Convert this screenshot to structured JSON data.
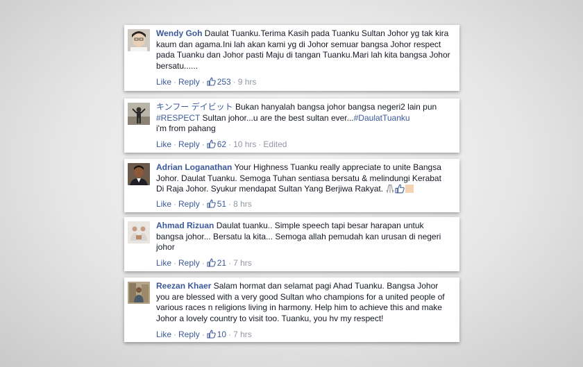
{
  "comments": [
    {
      "author": "Wendy Goh",
      "text": "Daulat Tuanku.Terima Kasih pada Tuanku Sultan Johor yg tak kira kaum dan agama.Ini lah akan kami yg di Johor semuar bangsa Johor respect pada Tuanku dan Johor pasti Maju di tangan Tuanku.Mari lah kita bangsa Johor bersatu......",
      "like_label": "Like",
      "reply_label": "Reply",
      "likes": "253",
      "time": "9 hrs"
    },
    {
      "author": "キンフー デイビット",
      "text_part1": "Bukan hanyalah bangsa johor bangsa negeri2 lain pun",
      "hashtag1": "#RESPECT",
      "text_part2": "Sultan johor...u are the best sultan ever...",
      "hashtag2": "#DaulatTuanku",
      "text_part3": "i'm from pahang",
      "like_label": "Like",
      "reply_label": "Reply",
      "likes": "62",
      "time": "10 hrs",
      "edited": "Edited"
    },
    {
      "author": "Adrian Loganathan",
      "text": "Your Highness Tuanku really appreciate to unite Bangsa Johor. Daulat Tuanku. Semoga Tuhan sentiasa bersatu & melindungi Kerabat Di Raja Johor. Syukur mendapat Sultan Yang Berjiwa Rakyat.",
      "like_label": "Like",
      "reply_label": "Reply",
      "likes": "51",
      "time": "8 hrs"
    },
    {
      "author": "Ahmad Rizuan",
      "text": "Daulat tuanku.. Simple speech tapi besar harapan untuk bangsa johor... Bersatu la kita... Semoga allah pemudah kan urusan di negeri johor",
      "like_label": "Like",
      "reply_label": "Reply",
      "likes": "21",
      "time": "7 hrs"
    },
    {
      "author": "Reezan Khaer",
      "text": "Salam hormat dan selamat pagi Ahad Tuanku. Bangsa Johor you are blessed with a very good Sultan who champions for a united people of various races n religions living in harmony. Help him to achieve this and make Johor a lovely country to visit too. Tuanku, you hv my respect!",
      "like_label": "Like",
      "reply_label": "Reply",
      "likes": "10",
      "time": "7 hrs"
    }
  ],
  "colors": {
    "link": "#3b5998",
    "text": "#141823",
    "meta": "#9197a3"
  }
}
